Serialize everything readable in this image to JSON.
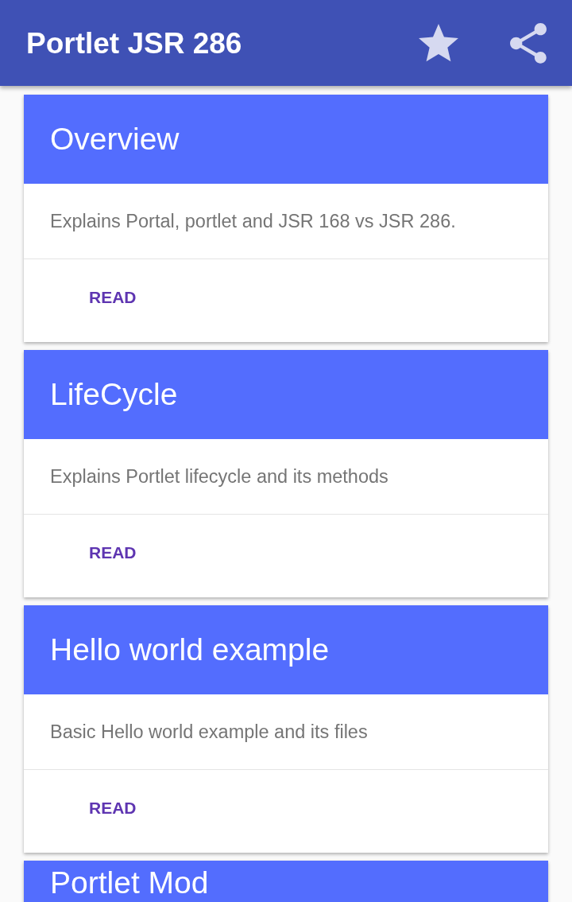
{
  "app_bar": {
    "title": "Portlet JSR 286"
  },
  "cards": [
    {
      "title": "Overview",
      "description": "Explains Portal, portlet and JSR 168 vs JSR 286.",
      "action": "READ"
    },
    {
      "title": "LifeCycle",
      "description": "Explains Portlet lifecycle and its methods",
      "action": "READ"
    },
    {
      "title": "Hello world example",
      "description": "Basic Hello world example and its files",
      "action": "READ"
    },
    {
      "title": "Portlet Mod"
    }
  ]
}
